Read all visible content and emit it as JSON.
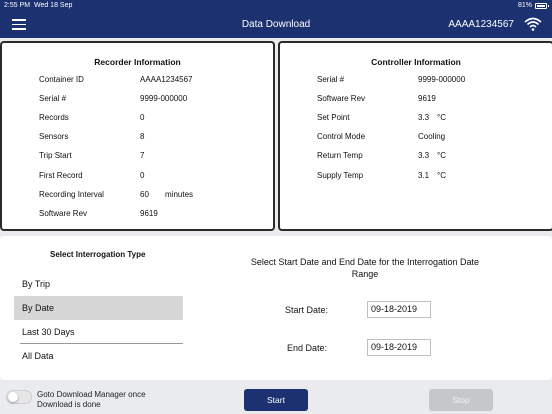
{
  "status": {
    "time": "2:55 PM",
    "date": "Wed 18 Sep",
    "battery": "81%",
    "battery_level": 0.81
  },
  "header": {
    "title": "Data Download",
    "device_id": "AAAA1234567"
  },
  "recorder": {
    "title": "Recorder Information",
    "rows": [
      {
        "label": "Container ID",
        "value": "AAAA1234567",
        "unit": ""
      },
      {
        "label": "Serial #",
        "value": "9999-000000",
        "unit": ""
      },
      {
        "label": "Records",
        "value": "0",
        "unit": ""
      },
      {
        "label": "Sensors",
        "value": "8",
        "unit": ""
      },
      {
        "label": "Trip Start",
        "value": "7",
        "unit": ""
      },
      {
        "label": "First Record",
        "value": "0",
        "unit": ""
      },
      {
        "label": "Recording Interval",
        "value": "60",
        "unit": "minutes"
      },
      {
        "label": "Software Rev",
        "value": "9619",
        "unit": ""
      }
    ]
  },
  "controller": {
    "title": "Controller Information",
    "rows": [
      {
        "label": "Serial #",
        "value": "9999-000000",
        "unit": ""
      },
      {
        "label": "Software Rev",
        "value": "9619",
        "unit": ""
      },
      {
        "label": "Set Point",
        "value": "3.3",
        "unit": "°C"
      },
      {
        "label": "Control Mode",
        "value": "Cooling",
        "unit": ""
      },
      {
        "label": "Return Temp",
        "value": "3.3",
        "unit": "°C"
      },
      {
        "label": "Supply Temp",
        "value": "3.1",
        "unit": "°C"
      }
    ]
  },
  "interrogation": {
    "title": "Select Interrogation Type",
    "options": [
      "By Trip",
      "By Date",
      "Last 30 Days",
      "All Data"
    ],
    "selected": "By Date"
  },
  "date_range": {
    "title": "Select Start Date and End Date for the Interrogation Date Range",
    "start_label": "Start Date:",
    "start_value": "09-18-2019",
    "end_label": "End Date:",
    "end_value": "09-18-2019"
  },
  "footer": {
    "toggle_label": "Goto Download Manager once Download is done",
    "toggle_on": false,
    "start_label": "Start",
    "stop_label": "Stop"
  },
  "colors": {
    "brand": "#1b3170",
    "selected": "#d6d6d6",
    "disabled": "#c6c7cb"
  }
}
